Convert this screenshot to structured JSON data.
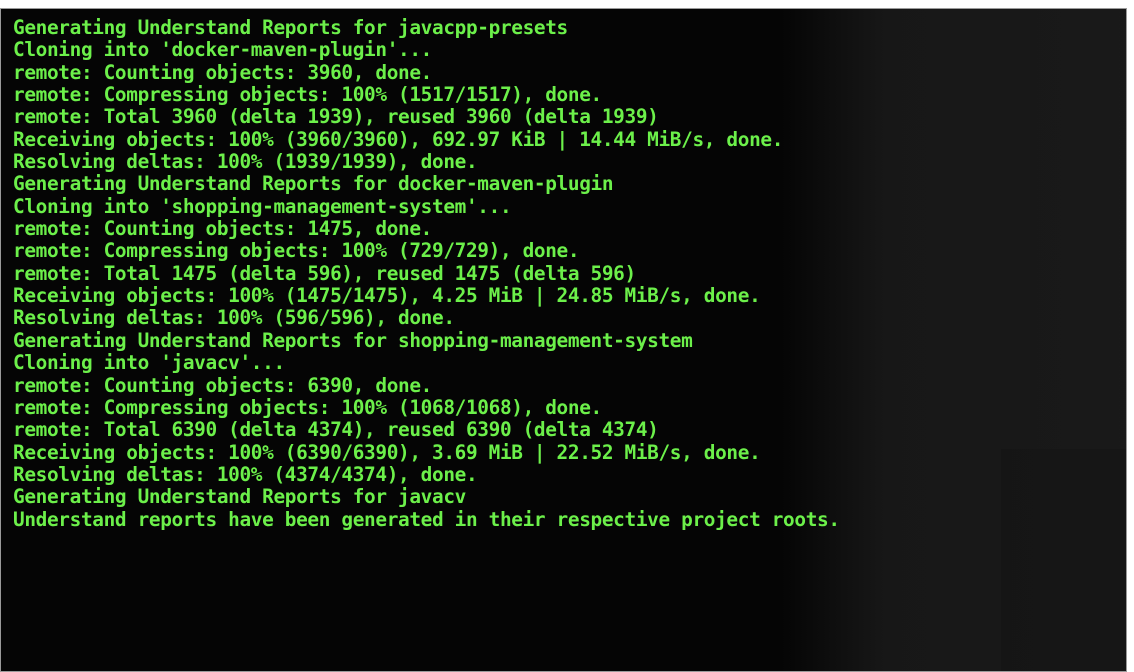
{
  "terminal": {
    "text_color": "#6cf04a",
    "background": "#050505",
    "lines": [
      "Generating Understand Reports for javacpp-presets",
      "Cloning into 'docker-maven-plugin'...",
      "remote: Counting objects: 3960, done.",
      "remote: Compressing objects: 100% (1517/1517), done.",
      "remote: Total 3960 (delta 1939), reused 3960 (delta 1939)",
      "Receiving objects: 100% (3960/3960), 692.97 KiB | 14.44 MiB/s, done.",
      "Resolving deltas: 100% (1939/1939), done.",
      "Generating Understand Reports for docker-maven-plugin",
      "Cloning into 'shopping-management-system'...",
      "remote: Counting objects: 1475, done.",
      "remote: Compressing objects: 100% (729/729), done.",
      "remote: Total 1475 (delta 596), reused 1475 (delta 596)",
      "Receiving objects: 100% (1475/1475), 4.25 MiB | 24.85 MiB/s, done.",
      "Resolving deltas: 100% (596/596), done.",
      "Generating Understand Reports for shopping-management-system",
      "Cloning into 'javacv'...",
      "remote: Counting objects: 6390, done.",
      "remote: Compressing objects: 100% (1068/1068), done.",
      "remote: Total 6390 (delta 4374), reused 6390 (delta 4374)",
      "Receiving objects: 100% (6390/6390), 3.69 MiB | 22.52 MiB/s, done.",
      "Resolving deltas: 100% (4374/4374), done.",
      "Generating Understand Reports for javacv",
      "Understand reports have been generated in their respective project roots."
    ]
  }
}
